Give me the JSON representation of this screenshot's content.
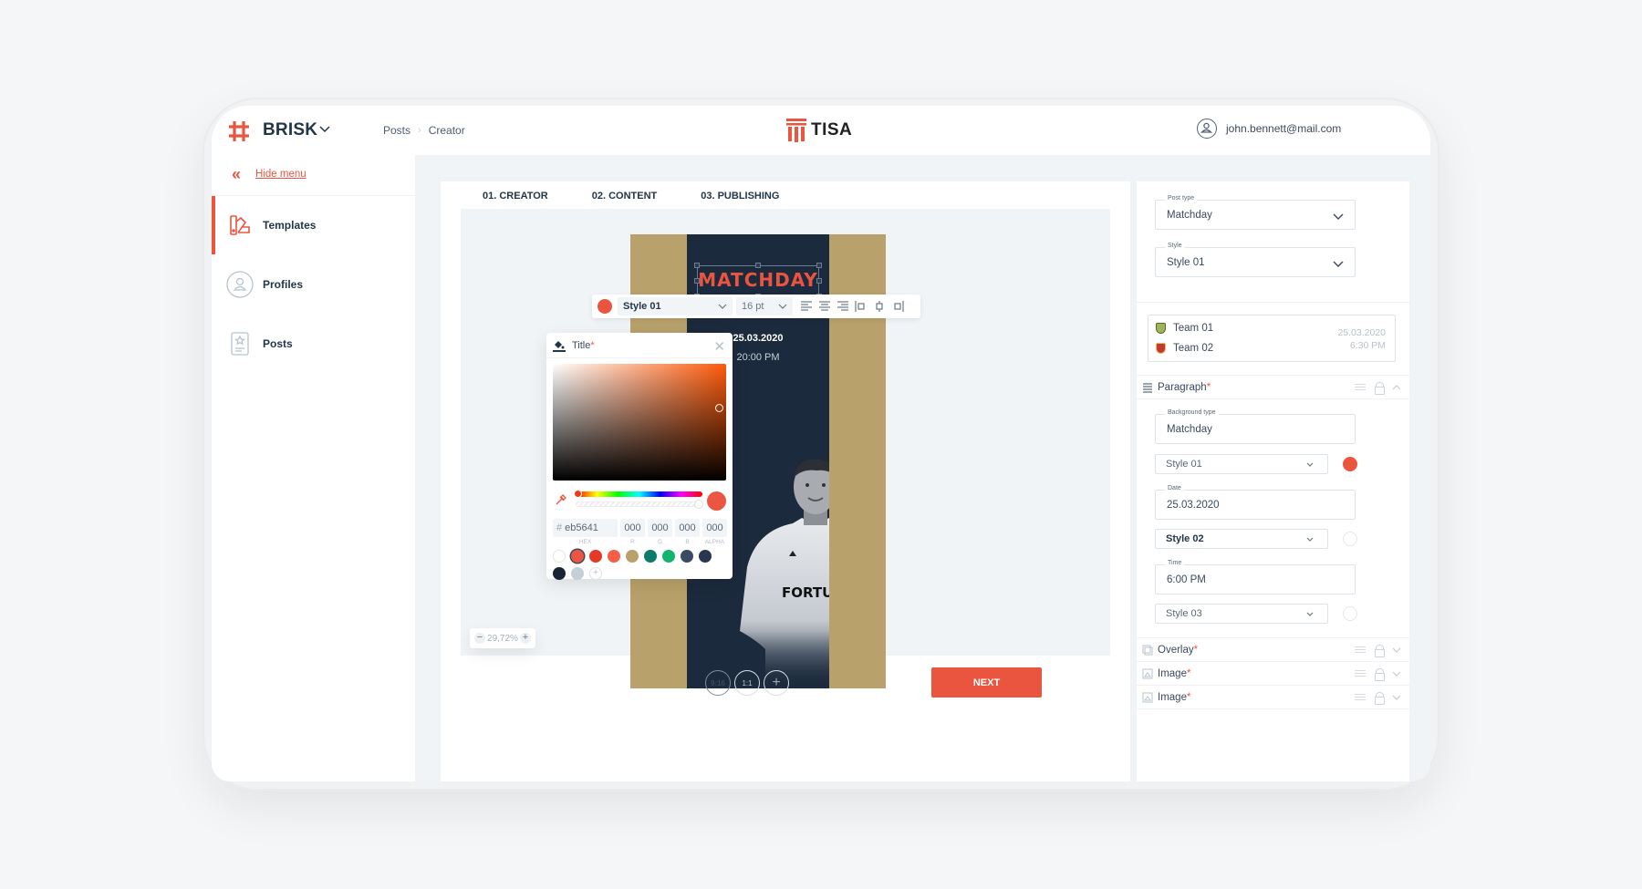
{
  "app": {
    "brand": "BRISK",
    "client_logo": "TISA",
    "breadcrumb": [
      "Posts",
      "Creator"
    ],
    "user_email": "john.bennett@mail.com"
  },
  "sidebar": {
    "hide_menu_label": "Hide menu",
    "items": [
      {
        "label": "Templates",
        "icon": "swatch-book-icon",
        "active": true
      },
      {
        "label": "Profiles",
        "icon": "user-circle-icon",
        "active": false
      },
      {
        "label": "Posts",
        "icon": "post-star-icon",
        "active": false
      }
    ]
  },
  "tabs": [
    {
      "label": "01. CREATOR",
      "active": true
    },
    {
      "label": "02. CONTENT",
      "active": false
    },
    {
      "label": "03. PUBLISHING",
      "active": false
    }
  ],
  "poster": {
    "title": "MATCHDAY",
    "date": "25.03.2020",
    "time": "20:00 PM",
    "sponsor": "FORTUNA",
    "colors": {
      "gold": "#b8a16b",
      "navy": "#1b2a3c",
      "accent": "#ea5540"
    }
  },
  "text_toolbar": {
    "style": "Style 01",
    "size": "16 pt",
    "color": "#ea5540"
  },
  "color_picker": {
    "label": "Title",
    "required_mark": "*",
    "hex": "eb5641",
    "hex_prefix": "#",
    "r": "000",
    "g": "000",
    "b": "000",
    "alpha": "000",
    "field_labels": [
      "HEX",
      "R",
      "G",
      "B",
      "ALPHA"
    ],
    "swatches": [
      "#ffffff",
      "#ea5641",
      "#e23a26",
      "#f65e47",
      "#b8a16b",
      "#0e7a6a",
      "#14b46e",
      "#3a4b66",
      "#26374e",
      "#172436",
      "#c6ced6"
    ],
    "selected_swatch": 1
  },
  "canvas": {
    "zoom": "29,72%",
    "ratios": [
      "9:16",
      "1:1"
    ],
    "active_ratio": "9:16",
    "next_label": "NEXT"
  },
  "right_panel": {
    "post_type": {
      "label": "Post type",
      "value": "Matchday"
    },
    "style": {
      "label": "Style",
      "value": "Style 01"
    },
    "match": {
      "team1": "Team 01",
      "team2": "Team 02",
      "date": "25.03.2020",
      "time": "6:30 PM"
    },
    "paragraph": {
      "label": "Paragraph",
      "background_type": {
        "label": "Background type",
        "value": "Matchday"
      },
      "style1": "Style 01",
      "style1_color": "#ea5540",
      "date": {
        "label": "Date",
        "value": "25.03.2020"
      },
      "style2": "Style 02",
      "time": {
        "label": "Time",
        "value": "6:00 PM"
      },
      "style3": "Style 03"
    },
    "sections": [
      {
        "label": "Overlay",
        "icon": "overlay-icon"
      },
      {
        "label": "Image",
        "icon": "image-icon"
      },
      {
        "label": "Image",
        "icon": "image-icon"
      }
    ],
    "required_mark": "*"
  }
}
